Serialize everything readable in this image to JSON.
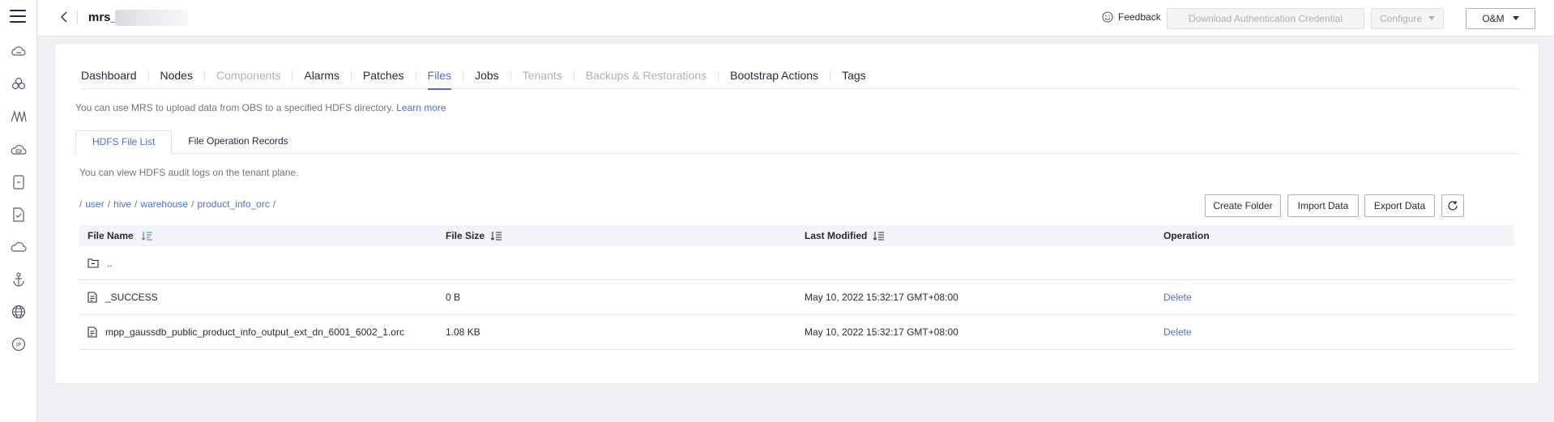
{
  "header": {
    "cluster_name": "mrs_",
    "feedback_label": "Feedback",
    "download_credential_label": "Download Authentication Credential",
    "configure_label": "Configure",
    "om_label": "O&M"
  },
  "rail_icons": [
    "cloud-icon",
    "cluster-icon",
    "analytics-icon",
    "cloud-search-icon",
    "storage-icon",
    "document-icon",
    "cloud-outline-icon",
    "anchor-icon",
    "globe-icon",
    "ip-icon"
  ],
  "tabs": [
    {
      "label": "Dashboard",
      "state": "normal"
    },
    {
      "label": "Nodes",
      "state": "normal"
    },
    {
      "label": "Components",
      "state": "disabled"
    },
    {
      "label": "Alarms",
      "state": "normal"
    },
    {
      "label": "Patches",
      "state": "normal"
    },
    {
      "label": "Files",
      "state": "active"
    },
    {
      "label": "Jobs",
      "state": "normal"
    },
    {
      "label": "Tenants",
      "state": "disabled"
    },
    {
      "label": "Backups & Restorations",
      "state": "disabled"
    },
    {
      "label": "Bootstrap Actions",
      "state": "normal"
    },
    {
      "label": "Tags",
      "state": "normal"
    }
  ],
  "upload_hint": "You can use MRS to upload data from OBS to a specified HDFS directory.",
  "learn_more": "Learn more",
  "subtabs": {
    "hdfs_file_list": "HDFS File List",
    "file_operation_records": "File Operation Records"
  },
  "audit_hint": "You can view HDFS audit logs on the tenant plane.",
  "breadcrumb": {
    "sep": "/",
    "parts": [
      "user",
      "hive",
      "warehouse",
      "product_info_orc"
    ]
  },
  "actions": {
    "create_folder": "Create Folder",
    "import_data": "Import Data",
    "export_data": "Export Data"
  },
  "table": {
    "columns": {
      "name": "File Name",
      "size": "File Size",
      "modified": "Last Modified",
      "operation": "Operation"
    },
    "parent_dir": "..",
    "rows": [
      {
        "name": "_SUCCESS",
        "size": "0 B",
        "modified": "May 10, 2022 15:32:17 GMT+08:00",
        "op": "Delete"
      },
      {
        "name": "mpp_gaussdb_public_product_info_output_ext_dn_6001_6002_1.orc",
        "size": "1.08 KB",
        "modified": "May 10, 2022 15:32:17 GMT+08:00",
        "op": "Delete"
      }
    ]
  },
  "colors": {
    "accent": "#526ecc",
    "text": "#252b3a",
    "muted": "#71757f",
    "disabled": "#adb0b8"
  }
}
